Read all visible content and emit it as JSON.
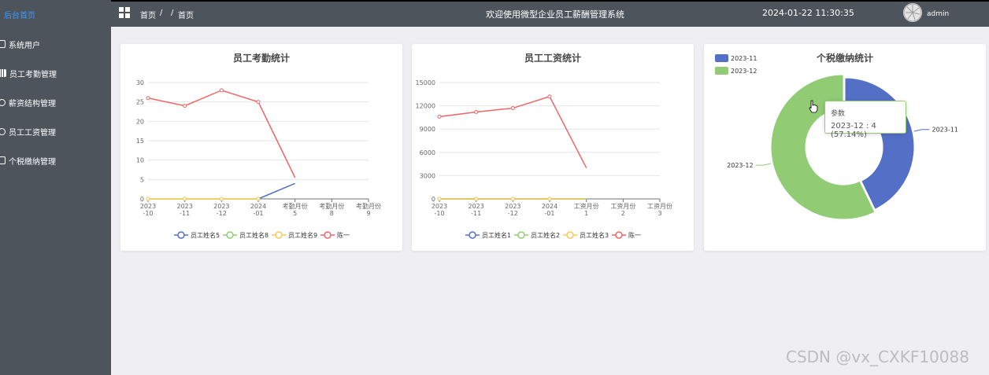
{
  "sidebar": {
    "items": [
      {
        "label": "后台首页",
        "active": true
      },
      {
        "label": "系统用户",
        "icon": "document-icon"
      },
      {
        "label": "员工考勤管理",
        "icon": "chart-icon"
      },
      {
        "label": "薪资结构管理",
        "icon": "circle-icon"
      },
      {
        "label": "员工工资管理",
        "icon": "check-icon"
      },
      {
        "label": "个税缴纳管理",
        "icon": "document-icon"
      }
    ]
  },
  "header": {
    "breadcrumb_home": "首页",
    "breadcrumb_sep": "/",
    "breadcrumb_sep2": "/",
    "breadcrumb_current": "首页",
    "welcome": "欢迎使用微型企业员工薪酬管理系统",
    "datetime": "2024-01-22 11:30:35",
    "username": "admin"
  },
  "colors": {
    "blue": "#5470c6",
    "green": "#91cc75",
    "yellow": "#fac858",
    "red": "#ee6666",
    "active_menu": "#3d9bff"
  },
  "chart_data": [
    {
      "type": "line",
      "title": "员工考勤统计",
      "categories": [
        "2023\n-10",
        "2023\n-11",
        "2023\n-12",
        "2024\n-01",
        "考勤月份\n5",
        "考勤月份\n8",
        "考勤月份\n9"
      ],
      "yticks": [
        0,
        5,
        10,
        15,
        20,
        25,
        30
      ],
      "ylim": [
        0,
        30
      ],
      "series": [
        {
          "name": "员工姓名5",
          "values": [
            null,
            null,
            null,
            0,
            4,
            null,
            null
          ]
        },
        {
          "name": "员工姓名8",
          "values": [
            0,
            0,
            0,
            0,
            null,
            null,
            null
          ]
        },
        {
          "name": "员工姓名9",
          "values": [
            0,
            0,
            0,
            0,
            null,
            null,
            null
          ]
        },
        {
          "name": "陈一",
          "values": [
            26,
            24,
            28,
            25,
            5.5,
            null,
            null
          ]
        }
      ]
    },
    {
      "type": "line",
      "title": "员工工资统计",
      "categories": [
        "2023\n-10",
        "2023\n-11",
        "2023\n-12",
        "2024\n-01",
        "工资月份\n1",
        "工资月份\n2",
        "工资月份\n3"
      ],
      "yticks": [
        0,
        3000,
        6000,
        9000,
        12000,
        15000
      ],
      "ylim": [
        0,
        15000
      ],
      "series": [
        {
          "name": "员工姓名1",
          "values": [
            0,
            0,
            0,
            0,
            0,
            null,
            null
          ]
        },
        {
          "name": "员工姓名2",
          "values": [
            0,
            0,
            0,
            0,
            0,
            null,
            null
          ]
        },
        {
          "name": "员工姓名3",
          "values": [
            0,
            0,
            0,
            0,
            0,
            null,
            null
          ]
        },
        {
          "name": "陈一",
          "values": [
            10600,
            11200,
            11700,
            13200,
            4000,
            null,
            null
          ]
        }
      ]
    },
    {
      "type": "pie",
      "title": "个税缴纳统计",
      "legend_position": "top-left",
      "slices": [
        {
          "label": "2023-11",
          "value": 3
        },
        {
          "label": "2023-12",
          "value": 4
        }
      ]
    }
  ],
  "tooltip": {
    "title": "参数",
    "text": "2023-12 : 4 (57.14%)"
  },
  "watermark": "CSDN @vx_CXKF10088"
}
